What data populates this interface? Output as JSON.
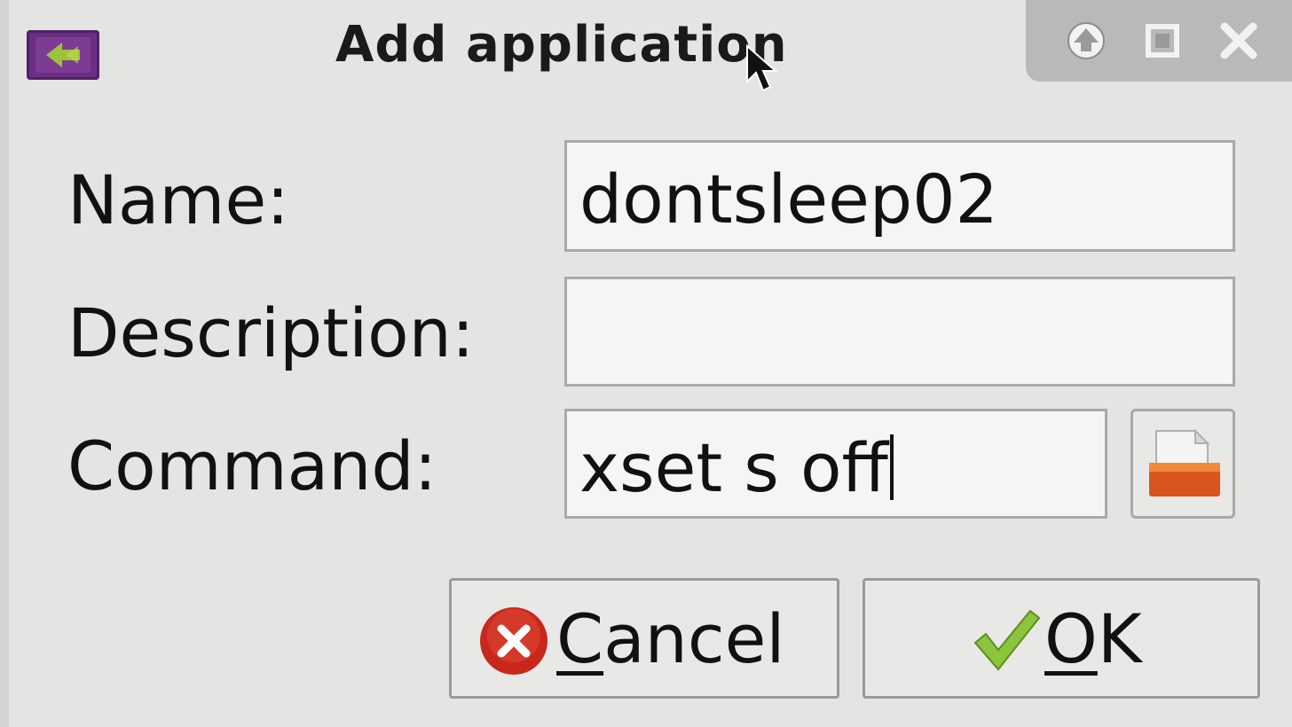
{
  "window": {
    "title": "Add application"
  },
  "form": {
    "name_label": "Name:",
    "name_value": "dontsleep02",
    "description_label": "Description:",
    "description_value": "",
    "command_label": "Command:",
    "command_value": "xset s off"
  },
  "buttons": {
    "cancel_mnemonic": "C",
    "cancel_rest": "ancel",
    "ok_mnemonic": "O",
    "ok_rest": "K"
  },
  "icons": {
    "app": "application-add-icon",
    "shade": "shade-up-icon",
    "maximize": "maximize-icon",
    "close": "close-icon",
    "browse": "folder-open-icon",
    "cancel": "cancel-icon",
    "ok": "checkmark-icon"
  },
  "colors": {
    "cancel_red": "#c8281c",
    "ok_green": "#8cc43c",
    "folder_orange": "#d9541e",
    "app_icon_purple": "#6a2f82"
  }
}
